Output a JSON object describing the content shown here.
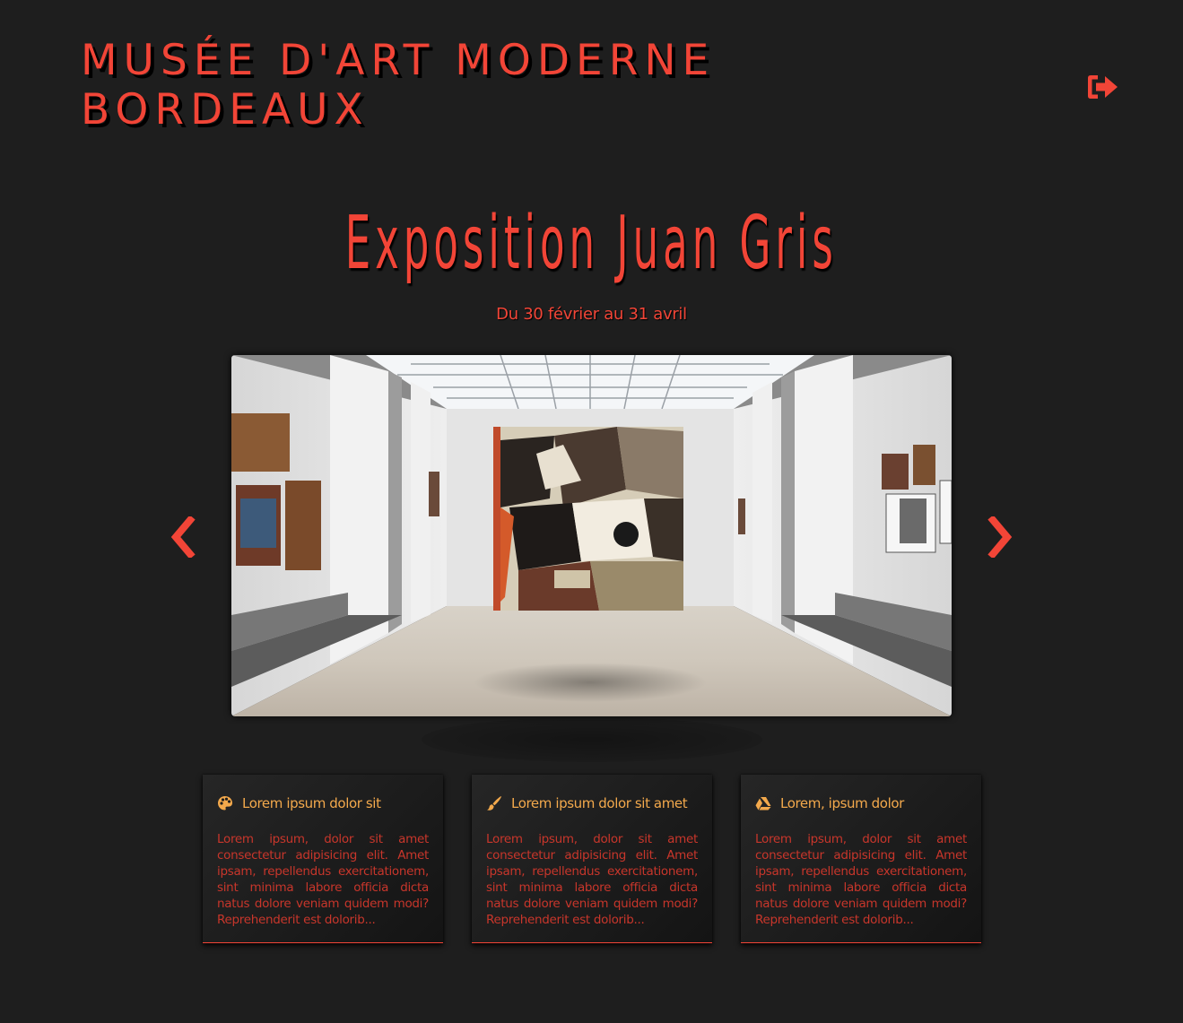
{
  "header": {
    "title_line1": "MUSÉE D'ART MODERNE",
    "title_line2": "BORDEAUX",
    "logout_icon": "sign-out-icon"
  },
  "exhibition": {
    "title": "Exposition Juan Gris",
    "dates": "Du 30 février au 31 avril"
  },
  "carousel": {
    "prev_icon": "chevron-left-icon",
    "next_icon": "chevron-right-icon",
    "image": "gallery-hall-with-juan-gris-painting"
  },
  "cards": [
    {
      "icon": "palette-icon",
      "title": "Lorem ipsum dolor sit",
      "text": "Lorem ipsum, dolor sit amet consectetur adipisicing elit. Amet ipsam, repellendus exercitationem, sint minima labore officia dicta natus dolore veniam quidem modi? Reprehenderit est dolorib..."
    },
    {
      "icon": "paint-brush-icon",
      "title": "Lorem ipsum dolor sit amet",
      "text": "Lorem ipsum, dolor sit amet consectetur adipisicing elit. Amet ipsam, repellendus exercitationem, sint minima labore officia dicta natus dolore veniam quidem modi? Reprehenderit est dolorib..."
    },
    {
      "icon": "google-drive-icon",
      "title": "Lorem, ipsum dolor",
      "text": "Lorem ipsum, dolor sit amet consectetur adipisicing elit. Amet ipsam, repellendus exercitationem, sint minima labore officia dicta natus dolore veniam quidem modi? Reprehenderit est dolorib..."
    }
  ],
  "colors": {
    "background": "#1e1e1e",
    "accent": "#f24537",
    "card_title": "#f3a94c",
    "card_text": "#c8362b"
  }
}
